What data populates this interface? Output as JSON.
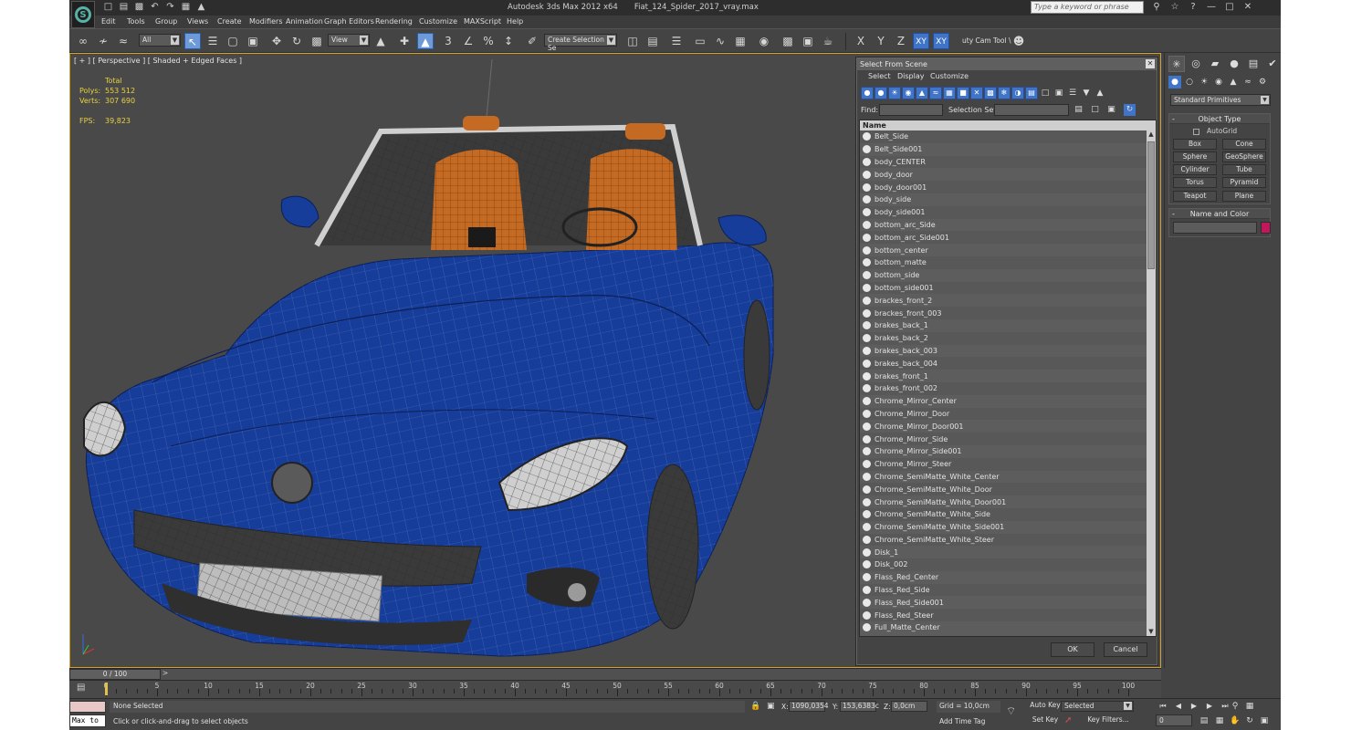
{
  "window": {
    "app_name": "Autodesk 3ds Max  2012 x64",
    "file_name": "Fiat_124_Spider_2017_vray.max",
    "search_placeholder": "Type a keyword or phrase"
  },
  "menu": [
    "Edit",
    "Tools",
    "Group",
    "Views",
    "Create",
    "Modifiers",
    "Animation",
    "Graph Editors",
    "Rendering",
    "Customize",
    "MAXScript",
    "Help"
  ],
  "toolbar": {
    "selection_filter": "All",
    "ref_coord": "View",
    "snap_labels": [
      "3",
      "%"
    ],
    "named_selection": "Create Selection Se",
    "axis": [
      "X",
      "Y",
      "Z",
      "XY",
      "XY"
    ],
    "cam_tool": "uty Cam Tool \\"
  },
  "viewport": {
    "label": "[ + ] [ Perspective ] [ Shaded + Edged Faces ]",
    "stats_header": "Total",
    "polys_label": "Polys:",
    "polys": "553 512",
    "verts_label": "Verts:",
    "verts": "307 690",
    "fps_label": "FPS:",
    "fps": "39,823"
  },
  "dialog": {
    "title": "Select From Scene",
    "menu": [
      "Select",
      "Display",
      "Customize"
    ],
    "find_label": "Find:",
    "selection_set_label": "Selection Set:",
    "column_header": "Name",
    "items": [
      "Belt_Side",
      "Belt_Side001",
      "body_CENTER",
      "body_door",
      "body_door001",
      "body_side",
      "body_side001",
      "bottom_arc_Side",
      "bottom_arc_Side001",
      "bottom_center",
      "bottom_matte",
      "bottom_side",
      "bottom_side001",
      "brackes_front_2",
      "brackes_front_003",
      "brakes_back_1",
      "brakes_back_2",
      "brakes_back_003",
      "brakes_back_004",
      "brakes_front_1",
      "brakes_front_002",
      "Chrome_Mirror_Center",
      "Chrome_Mirror_Door",
      "Chrome_Mirror_Door001",
      "Chrome_Mirror_Side",
      "Chrome_Mirror_Side001",
      "Chrome_Mirror_Steer",
      "Chrome_SemiMatte_White_Center",
      "Chrome_SemiMatte_White_Door",
      "Chrome_SemiMatte_White_Door001",
      "Chrome_SemiMatte_White_Side",
      "Chrome_SemiMatte_White_Side001",
      "Chrome_SemiMatte_White_Steer",
      "Disk_1",
      "Disk_002",
      "Flass_Red_Center",
      "Flass_Red_Side",
      "Flass_Red_Side001",
      "Flass_Red_Steer",
      "Full_Matte_Center"
    ],
    "ok": "OK",
    "cancel": "Cancel"
  },
  "command_panel": {
    "category": "Standard Primitives",
    "object_type_title": "Object Type",
    "autogrid": "AutoGrid",
    "buttons": [
      "Box",
      "Cone",
      "Sphere",
      "GeoSphere",
      "Cylinder",
      "Tube",
      "Torus",
      "Pyramid",
      "Teapot",
      "Plane"
    ],
    "name_color_title": "Name and Color",
    "swatch_color": "#c2185b"
  },
  "timeline": {
    "slider": "0 / 100",
    "ticks": [
      "0",
      "5",
      "10",
      "15",
      "20",
      "25",
      "30",
      "35",
      "40",
      "45",
      "50",
      "55",
      "60",
      "65",
      "70",
      "75",
      "80",
      "85",
      "90",
      "95",
      "100"
    ]
  },
  "status": {
    "maxscript": "Max to",
    "selection": "None Selected",
    "prompt": "Click or click-and-drag to select objects",
    "x_label": "X:",
    "x": "1090,0354",
    "y_label": "Y:",
    "y": "153,6383c",
    "z_label": "Z:",
    "z": "0,0cm",
    "grid": "Grid = 10,0cm",
    "add_time_tag": "Add Time Tag",
    "auto_key": "Auto Key",
    "set_key": "Set Key",
    "key_mode": "Selected",
    "key_filters": "Key Filters...",
    "frame": "0"
  },
  "colors": {
    "car_body": "#163d9a",
    "interior": "#c56a23",
    "viewport_bg": "#494949",
    "stats_text": "#e8d23e",
    "selection_blue": "#3f74c9"
  }
}
